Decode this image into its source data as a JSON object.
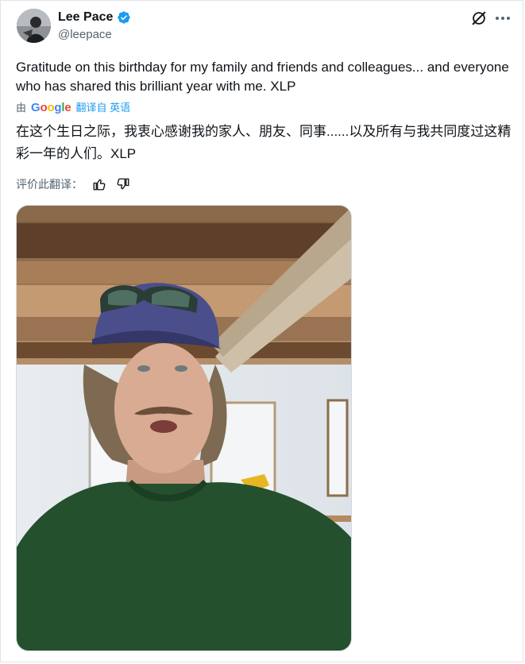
{
  "tweet": {
    "display_name": "Lee Pace",
    "handle": "@leepace",
    "text": "Gratitude on this birthday for my family and friends and colleagues... and everyone who has shared this brilliant year with me. XLP",
    "translated_text": "在这个生日之际，我衷心感谢我的家人、朋友、同事......以及所有与我共同度过这精彩一年的人们。XLP"
  },
  "translation": {
    "by_label": "由",
    "google_letters": [
      "G",
      "o",
      "o",
      "g",
      "l",
      "e"
    ],
    "translated_from_label": "翻译自 英语",
    "rate_label": "评价此翻译："
  },
  "icons": {
    "verified": "verified-badge-icon",
    "grok": "grok-icon",
    "more": "more-icon",
    "thumbs_up": "thumbs-up-icon",
    "thumbs_down": "thumbs-down-icon"
  },
  "colors": {
    "accent": "#1d9bf0",
    "text": "#0f1419",
    "secondary": "#536471",
    "google_blue": "#4285f4",
    "google_red": "#ea4335",
    "google_yellow": "#fbbc05",
    "google_green": "#34a853"
  }
}
